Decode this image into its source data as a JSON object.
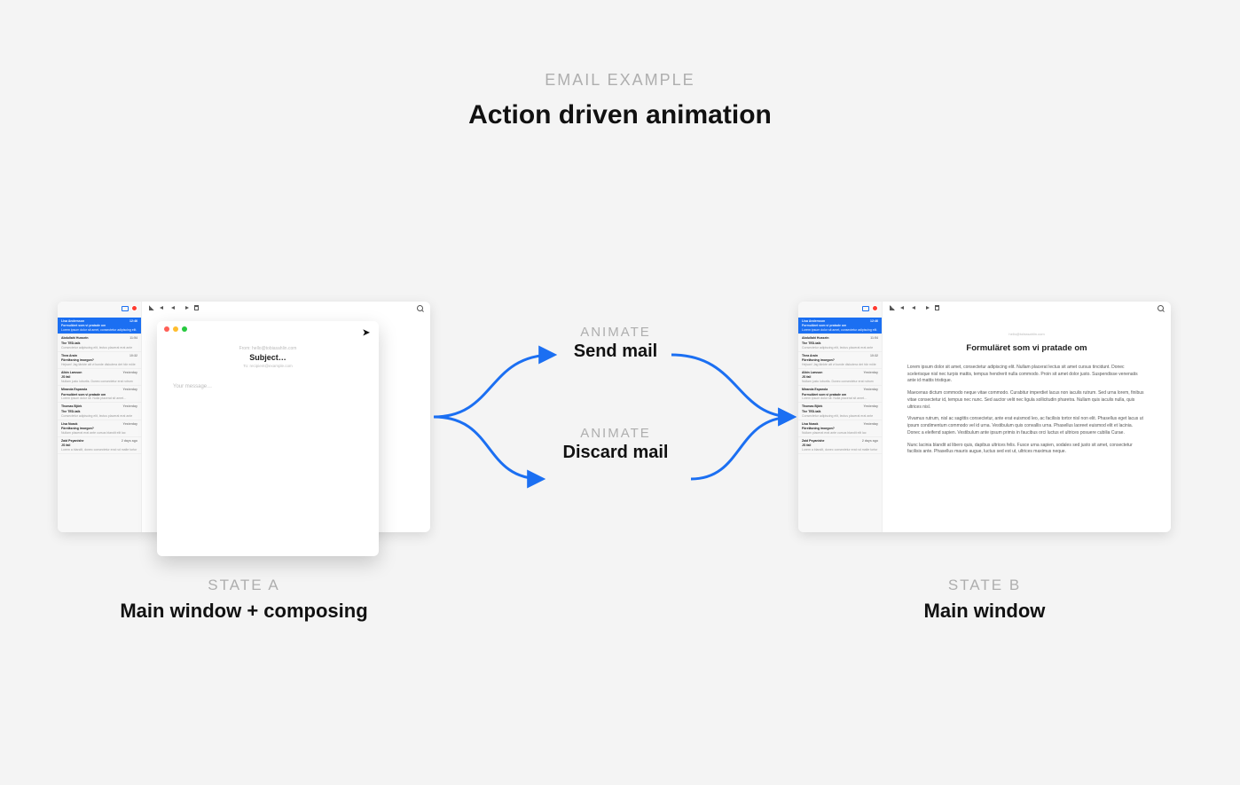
{
  "header": {
    "eyebrow": "EMAIL EXAMPLE",
    "title": "Action driven animation"
  },
  "captions": {
    "stateA": {
      "eyebrow": "STATE A",
      "label": "Main window + composing"
    },
    "stateB": {
      "eyebrow": "STATE B",
      "label": "Main window"
    }
  },
  "branches": {
    "top": {
      "eyebrow": "ANIMATE",
      "label": "Send mail"
    },
    "bottom": {
      "eyebrow": "ANIMATE",
      "label": "Discard mail"
    }
  },
  "sidebar_time_badge": "12:46",
  "messages": [
    {
      "from": "Lisa Andersson",
      "subject": "Formuläret som vi pratade om",
      "time": "12:46",
      "snippet": "Lorem ipsum dolor sit amet, consectetur adipiscing elit. Nulla placerat …",
      "selected": true
    },
    {
      "from": "Abdullahi Hussein",
      "subject": "The TED-talk",
      "time": "11:54",
      "snippet": "Consectetur adipiscing elit, lectus placerat erat ante cursus blandit…"
    },
    {
      "from": "Thea Arain",
      "subject": "Föreläsning imorgon?",
      "time": "10:32",
      "snippet": "Hejsan! Jag tänkte att vi kunde diskutera det här möte imorgon…"
    },
    {
      "from": "Albin Larsson",
      "subject": "JS fail",
      "time": "Yesterday",
      "snippet": "Nullam justo lobortis. Donec consectetur erat rutrum consequat…"
    },
    {
      "from": "Miranda Esparola",
      "subject": "Formuläret som vi pratade om",
      "time": "Yesterday",
      "snippet": "Lorem ipsum dolor sit. Nulla placerat sit amet…"
    },
    {
      "from": "Thomas Björk",
      "subject": "The TED-talk",
      "time": "Yesterday",
      "snippet": "Consectetur adipiscing elit, lectus placerat erat ante cursus…"
    },
    {
      "from": "Lisa Noack",
      "subject": "Föreläsning imorgon?",
      "time": "Yesterday",
      "snippet": "Nullam placerat erat ante cursus blandit elit lac tincidunt…"
    },
    {
      "from": "Zaid Psyanishe",
      "subject": "JS fail",
      "time": "2 days ago",
      "snippet": "Lorem a blandit, donec consectetur erat rut malte tortor hendrerit…"
    }
  ],
  "compose": {
    "from_line": "From: hello@tobiasahlin.com",
    "subject_placeholder": "Subject…",
    "to_line": "To: recipient@example.com",
    "body_placeholder": "Your message…"
  },
  "read": {
    "meta_line": "hello@tobiasahlin.com",
    "title": "Formuläret som vi pratade om",
    "paragraphs": [
      "Lorem ipsum dolor sit amet, consectetur adipiscing elit. Nullam placerat lectus sit amet cursus tincidunt. Donec scelerisque nisl nec turpis mattis, tempus hendrerit nulla commodo. Proin sit amet dolor justo. Suspendisse venenatis ante id mattis tristique.",
      "Maecenas dictum commodo neque vitae commodo. Curabitur imperdiet lacus non iaculis rutrum. Sed urna lorem, finibus vitae consectetur id, tempus nec nunc. Sed auctor velit nec ligula sollicitudin pharetra. Nullam quis iaculis nulla, quis ultrices nisl.",
      "Vivamus rutrum, nisl ac sagittis consectetur, ante erat euismod leo, ac facilisis tortor nisl non elit. Phasellus eget lacus ut ipsum condimentum commodo vel id urna. Vestibulum quis convallis urna. Phasellus laoreet euismod elit et lacinia. Donec a eleifend sapien. Vestibulum ante ipsum primis in faucibus orci luctus et ultrices posuere cubilia Curae.",
      "Nunc lacinia blandit at libero quis, dapibus ultrices felis. Fusce urna sapien, sodales sed justo sit amet, consectetur facilisis ante. Phasellus mauris augue, luctus sed est ut, ultrices maximus neque."
    ]
  },
  "colors": {
    "arrow": "#1b6ff2",
    "selection": "#1b6ff2"
  }
}
